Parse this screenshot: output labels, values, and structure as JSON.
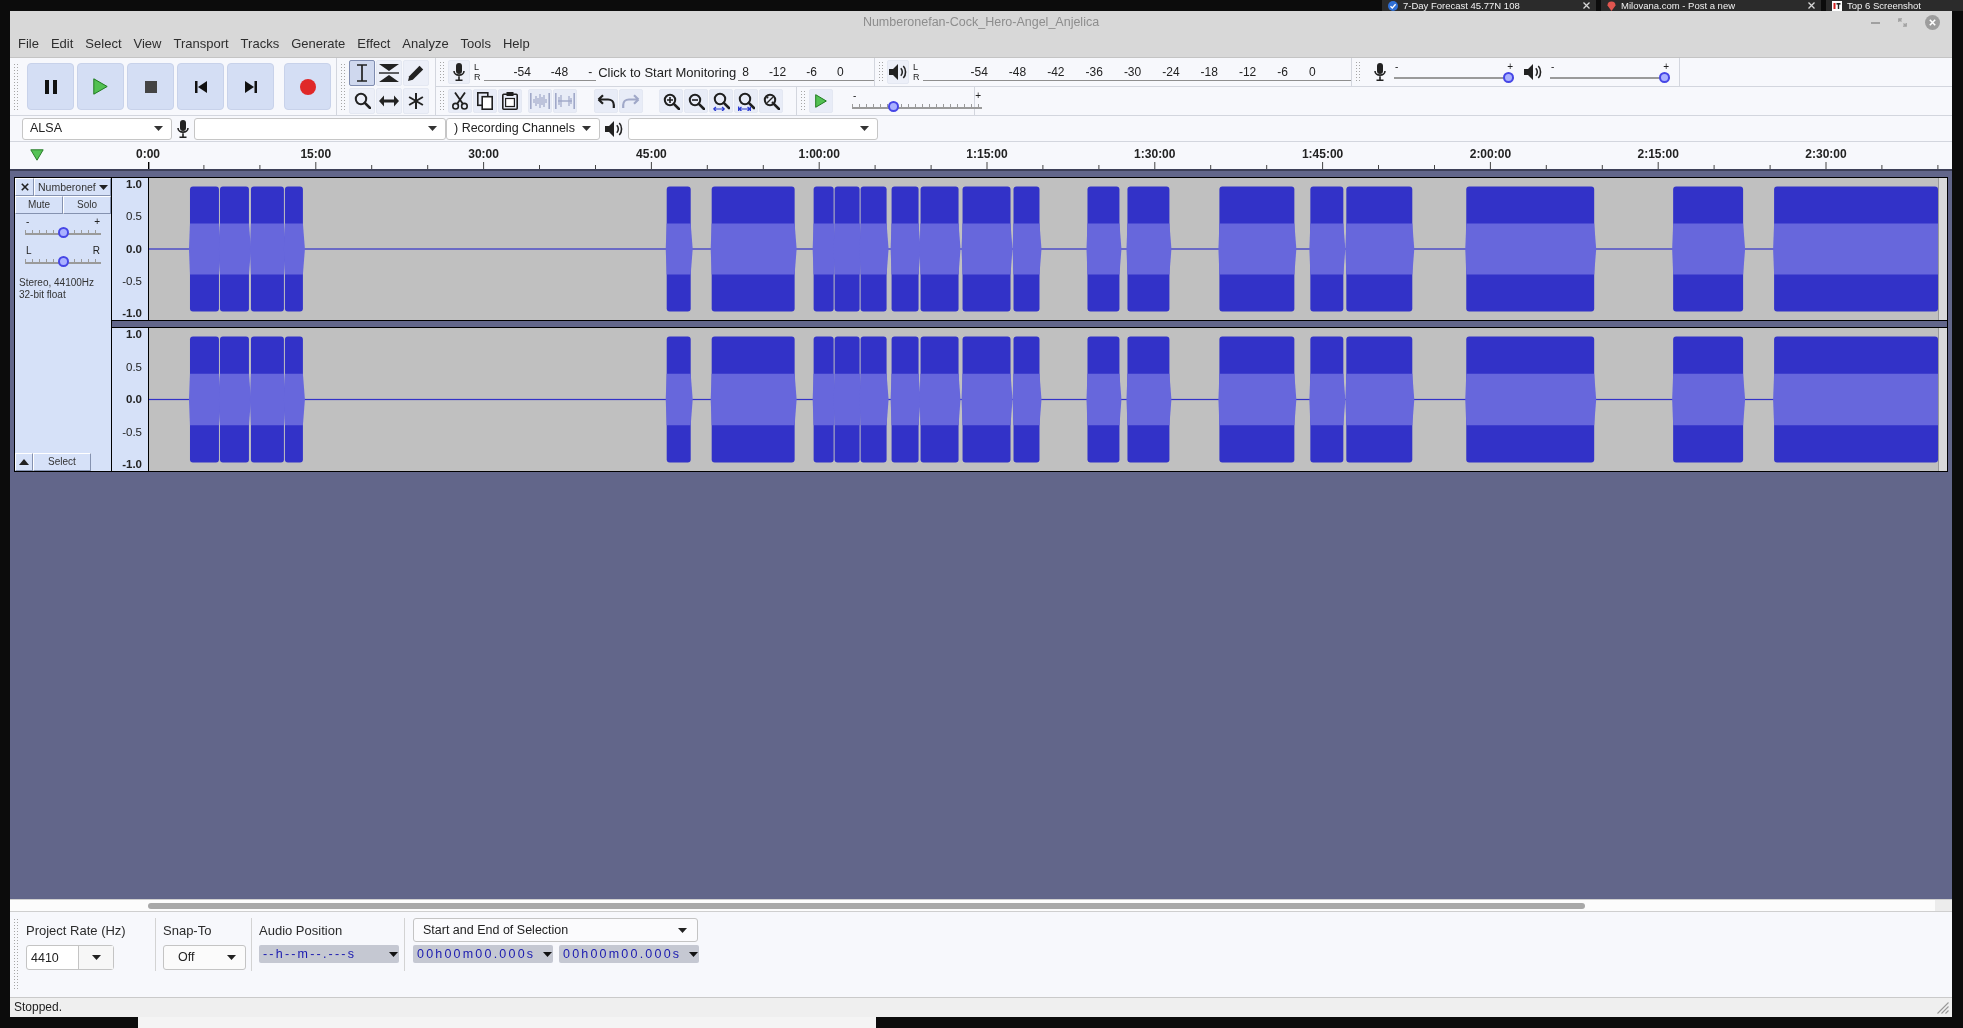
{
  "desktop": {
    "tabs": [
      {
        "label": "7-Day Forecast 45.77N 108",
        "kind": "weather",
        "closable": true
      },
      {
        "label": "Milovana.com - Post a new",
        "kind": "pin",
        "closable": true
      },
      {
        "label": "Top 6 Screenshot",
        "kind": "logo",
        "closable": false
      }
    ]
  },
  "window": {
    "title": "Numberonefan-Cock_Hero-Angel_Anjelica"
  },
  "menu": [
    "File",
    "Edit",
    "Select",
    "View",
    "Transport",
    "Tracks",
    "Generate",
    "Effect",
    "Analyze",
    "Tools",
    "Help"
  ],
  "transport": [
    {
      "kind": "pause"
    },
    {
      "kind": "play"
    },
    {
      "kind": "stop"
    },
    {
      "kind": "skip_start"
    },
    {
      "kind": "skip_end"
    },
    {
      "kind": "record"
    }
  ],
  "tools": [
    {
      "kind": "select",
      "selected": true
    },
    {
      "kind": "envelope",
      "selected": false
    },
    {
      "kind": "draw",
      "selected": false
    },
    {
      "kind": "zoom",
      "selected": false
    },
    {
      "kind": "time_shift",
      "selected": false
    },
    {
      "kind": "multi",
      "selected": false
    }
  ],
  "recording_meter": {
    "channels": [
      "L",
      "R"
    ],
    "scale_before": [
      "-54",
      "-48",
      "-"
    ],
    "prompt": "Click to Start Monitoring",
    "scale_after": [
      "8",
      "-12",
      "-6",
      "0"
    ]
  },
  "playback_meter": {
    "channels": [
      "L",
      "R"
    ],
    "scale": [
      "-54",
      "-48",
      "-42",
      "-36",
      "-30",
      "-24",
      "-18",
      "-12",
      "-6",
      "0"
    ]
  },
  "mixer": {
    "recording_volume": {
      "min": "-",
      "max": "+",
      "level": 1
    },
    "playback_volume": {
      "min": "-",
      "max": "+",
      "level": 1
    }
  },
  "edit_tools": [
    {
      "kind": "cut",
      "disabled": false
    },
    {
      "kind": "copy",
      "disabled": false
    },
    {
      "kind": "paste",
      "disabled": false
    },
    {
      "kind": "trim",
      "disabled": true
    },
    {
      "kind": "silence",
      "disabled": true
    },
    {
      "kind": "undo",
      "disabled": false
    },
    {
      "kind": "redo",
      "disabled": true
    },
    {
      "kind": "zoom_in",
      "disabled": false
    },
    {
      "kind": "zoom_out",
      "disabled": false
    },
    {
      "kind": "fit_selection",
      "disabled": false
    },
    {
      "kind": "fit_project",
      "disabled": false
    },
    {
      "kind": "zoom_toggle",
      "disabled": false
    }
  ],
  "play_at_speed": {
    "min": "-",
    "max": "+",
    "level": 0.3
  },
  "device_toolbar": {
    "host": "ALSA",
    "recording_channels": ") Recording Channels"
  },
  "timeline": {
    "labels": [
      "0:00",
      "15:00",
      "30:00",
      "45:00",
      "1:00:00",
      "1:15:00",
      "1:30:00",
      "1:45:00",
      "2:00:00",
      "2:15:00",
      "2:30:00"
    ]
  },
  "track": {
    "name": "Numberonef",
    "mute": {
      "label": "Mute",
      "on": false
    },
    "solo": {
      "label": "Solo",
      "on": false
    },
    "gain": {
      "min": "-",
      "max": "+",
      "level": 0.5
    },
    "pan": {
      "min": "L",
      "max": "R",
      "level": 0.5
    },
    "info": [
      "Stereo, 44100Hz",
      "32-bit float"
    ],
    "select_label": "Select",
    "channels": [
      {
        "scale": [
          {
            "label": "1.0",
            "kind": "major"
          },
          {
            "label": "0.5",
            "kind": "minor"
          },
          {
            "label": "0.0",
            "kind": "major"
          },
          {
            "label": "-0.5",
            "kind": "minor"
          },
          {
            "label": "-1.0",
            "kind": "major"
          }
        ]
      },
      {
        "scale": [
          {
            "label": "1.0",
            "kind": "major"
          },
          {
            "label": "0.5",
            "kind": "minor"
          },
          {
            "label": "0.0",
            "kind": "major"
          },
          {
            "label": "-0.5",
            "kind": "minor"
          },
          {
            "label": "-1.0",
            "kind": "major"
          }
        ]
      }
    ]
  },
  "selection_toolbar": {
    "project_rate": {
      "label": "Project Rate (Hz)",
      "value": "4410"
    },
    "snap_to": {
      "label": "Snap-To",
      "value": "Off"
    },
    "audio_position": {
      "label": "Audio Position",
      "value": "--h--m--.---s"
    },
    "selection": {
      "mode": "Start and End of Selection",
      "start": "00h00m00.000s",
      "end": "00h00m00.000s"
    }
  },
  "status_bar": {
    "text": "Stopped."
  }
}
